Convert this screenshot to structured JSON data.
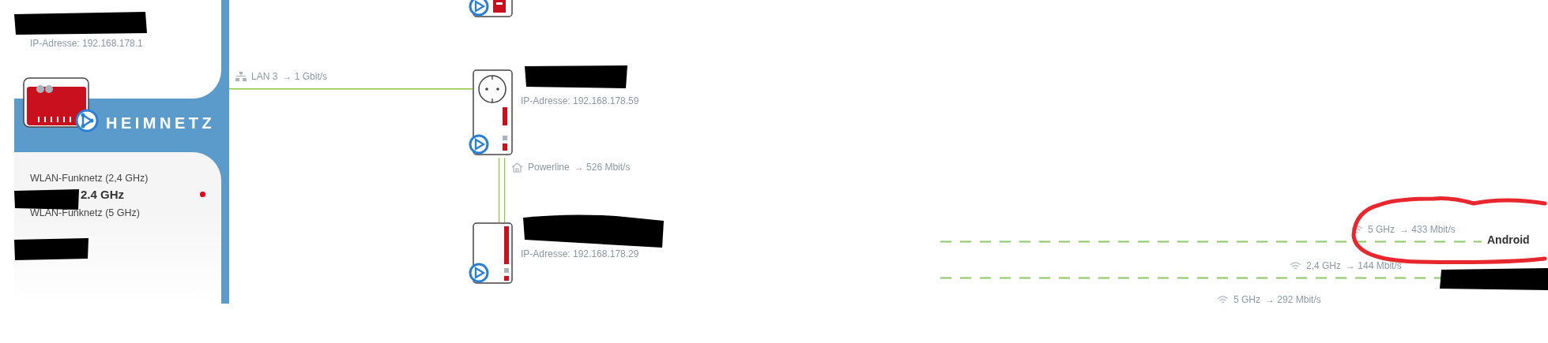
{
  "sidebar": {
    "router_ip": "IP-Adresse: 192.168.178.1",
    "title": "HEIMNETZ",
    "networks": [
      {
        "label": "WLAN-Funknetz (2,4 GHz)",
        "name": "2.4 GHz",
        "active": true
      },
      {
        "label": "WLAN-Funknetz (5 GHz)",
        "active": false
      }
    ]
  },
  "diagram": {
    "lan_link": {
      "port": "LAN 3",
      "speed": "→ 1 Gbit/s"
    },
    "devices": [
      {
        "kind": "partial"
      },
      {
        "kind": "socket-adapter",
        "ip": "IP-Adresse: 192.168.178.59"
      },
      {
        "kind": "adapter",
        "ip": "IP-Adresse: 192.168.178.29"
      }
    ],
    "powerline_link": {
      "label": "Powerline",
      "speed": "→ 526 Mbit/s"
    }
  },
  "clients": [
    {
      "band": "5 GHz",
      "speed": "→ 433 Mbit/s",
      "name": "Android",
      "highlighted": true
    },
    {
      "band": "2,4 GHz",
      "speed": "→ 144 Mbit/s",
      "highlighted": false
    },
    {
      "band": "5 GHz",
      "speed": "→ 292 Mbit/s",
      "highlighted": false
    }
  ]
}
